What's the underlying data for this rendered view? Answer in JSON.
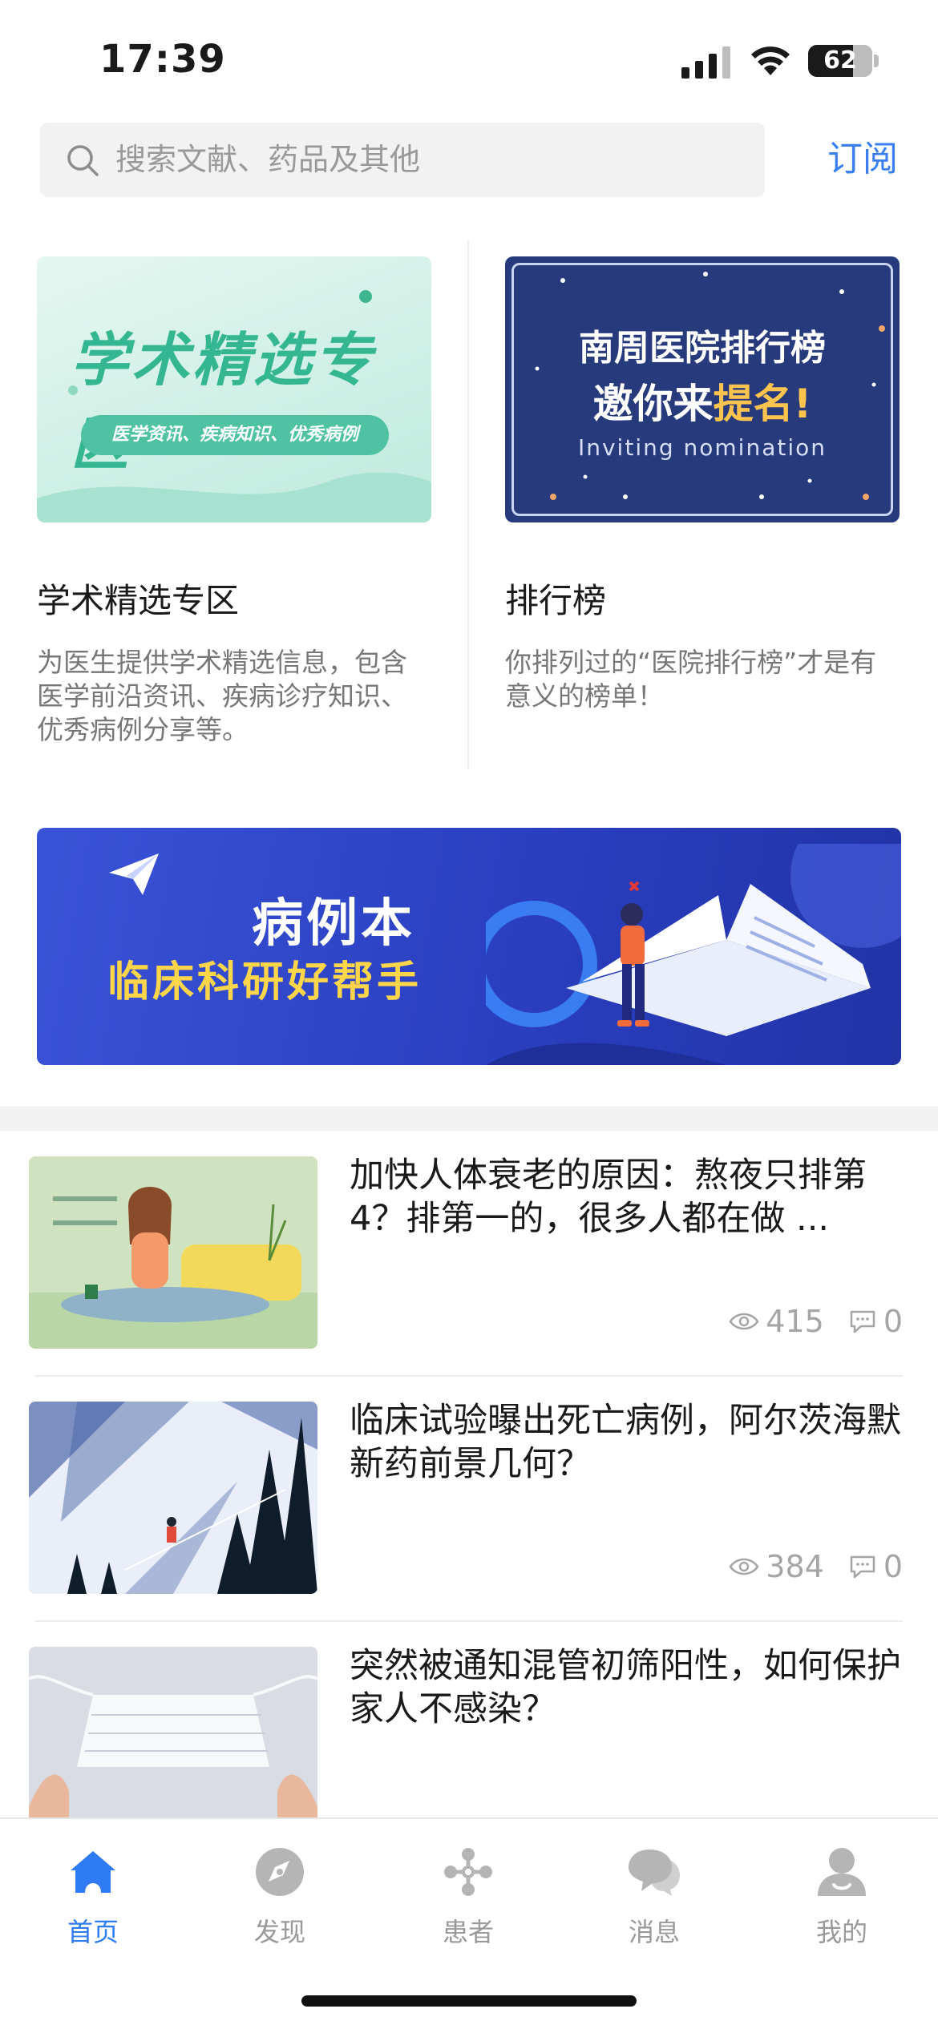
{
  "status_bar": {
    "time": "17:39",
    "battery": "62",
    "icons": [
      "cellular-signal-icon",
      "wifi-icon",
      "battery-icon"
    ]
  },
  "search": {
    "placeholder": "搜索文献、药品及其他",
    "icon": "search-icon"
  },
  "subscribe_label": "订阅",
  "feature_cards": [
    {
      "title": "学术精选专区",
      "description": "为医生提供学术精选信息，包含医学前沿资讯、疾病诊疗知识、优秀病例分享等。",
      "image_text": {
        "headline": "学术精选专区",
        "tagline": "医学资讯、疾病知识、优秀病例"
      }
    },
    {
      "title": "排行榜",
      "description": "你排列过的“医院排行榜”才是有意义的榜单！",
      "image_text": {
        "line1": "南周医院排行榜",
        "line2_a": "邀你来",
        "line2_b": "提名!",
        "line3": "Inviting nomination"
      }
    }
  ],
  "banner": {
    "title": "病例本",
    "subtitle": "临床科研好帮手"
  },
  "articles": [
    {
      "title": "加快人体衰老的原因：熬夜只排第4？排第一的，很多人都在做 ...",
      "views": "415",
      "comments": "0"
    },
    {
      "title": "临床试验曝出死亡病例，阿尔茨海默新药前景几何？",
      "views": "384",
      "comments": "0"
    },
    {
      "title": "突然被通知混管初筛阳性，如何保护家人不感染？",
      "views": "",
      "comments": ""
    }
  ],
  "tab_bar": {
    "items": [
      {
        "label": "首页",
        "icon": "home-icon",
        "active": true
      },
      {
        "label": "发现",
        "icon": "compass-icon",
        "active": false
      },
      {
        "label": "患者",
        "icon": "patients-network-icon",
        "active": false
      },
      {
        "label": "消息",
        "icon": "chat-bubbles-icon",
        "active": false
      },
      {
        "label": "我的",
        "icon": "profile-icon",
        "active": false
      }
    ]
  },
  "colors": {
    "accent": "#3a7ef0",
    "tab_active": "#2f7bf5",
    "tab_inactive": "#b5b5b5",
    "banner_blue": "#2f46c8",
    "banner_yellow": "#ffd54a"
  }
}
